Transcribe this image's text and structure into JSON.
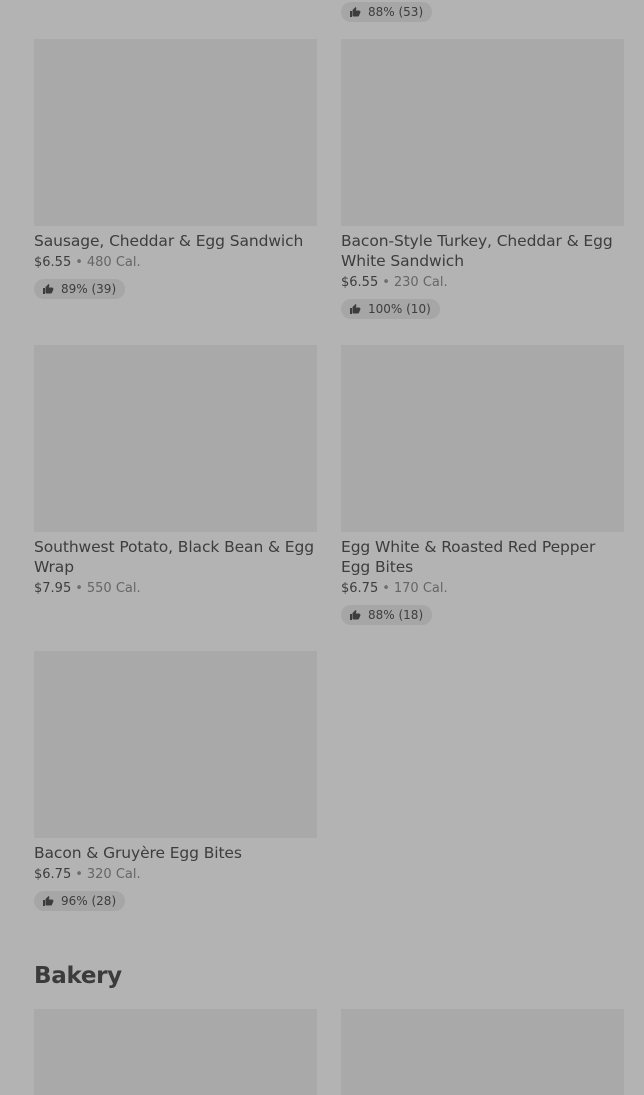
{
  "top_partial": {
    "rating": "88% (53)"
  },
  "breakfast": [
    {
      "title": "Sausage, Cheddar & Egg Sandwich",
      "price": "$6.55",
      "calories": "480 Cal.",
      "rating": "89% (39)"
    },
    {
      "title": "Bacon-Style Turkey, Cheddar & Egg White Sandwich",
      "price": "$6.55",
      "calories": "230 Cal.",
      "rating": "100% (10)"
    },
    {
      "title": "Southwest Potato, Black Bean & Egg Wrap",
      "price": "$7.95",
      "calories": "550 Cal."
    },
    {
      "title": "Egg White & Roasted Red Pepper Egg Bites",
      "price": "$6.75",
      "calories": "170 Cal.",
      "rating": "88% (18)"
    },
    {
      "title": "Bacon & Gruyère Egg Bites",
      "price": "$6.75",
      "calories": "320 Cal.",
      "rating": "96% (28)"
    }
  ],
  "bakery": {
    "title": "Bakery"
  },
  "meta_separator": "•",
  "icons": {
    "rating": "thumbs-up-icon"
  }
}
